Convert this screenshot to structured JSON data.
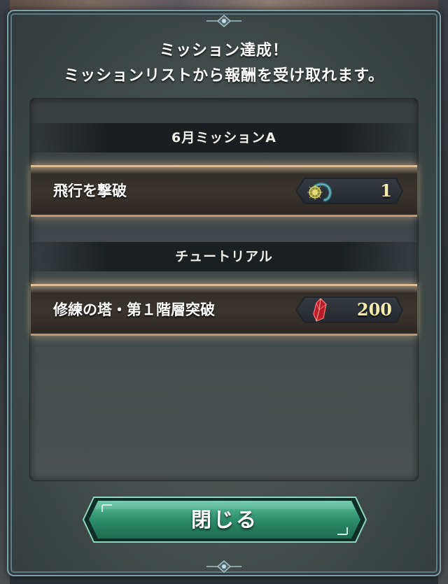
{
  "dialog": {
    "header_line1": "ミッション達成！",
    "header_line2": "ミッションリストから報酬を受け取れます。"
  },
  "categories": [
    {
      "title": "6月ミッションA",
      "missions": [
        {
          "name": "飛行を撃破",
          "reward_icon": "orb-icon",
          "reward_value": "1"
        }
      ]
    },
    {
      "title": "チュートリアル",
      "missions": [
        {
          "name": "修練の塔・第１階層突破",
          "reward_icon": "red-crystal-shard-icon",
          "reward_value": "200"
        }
      ]
    }
  ],
  "close_button": {
    "label": "閉じる"
  },
  "colors": {
    "frame": "#7f9ea6",
    "row_border": "#d9bd94",
    "reward_text": "#f3eab0",
    "button_green": "#3b9a78"
  }
}
